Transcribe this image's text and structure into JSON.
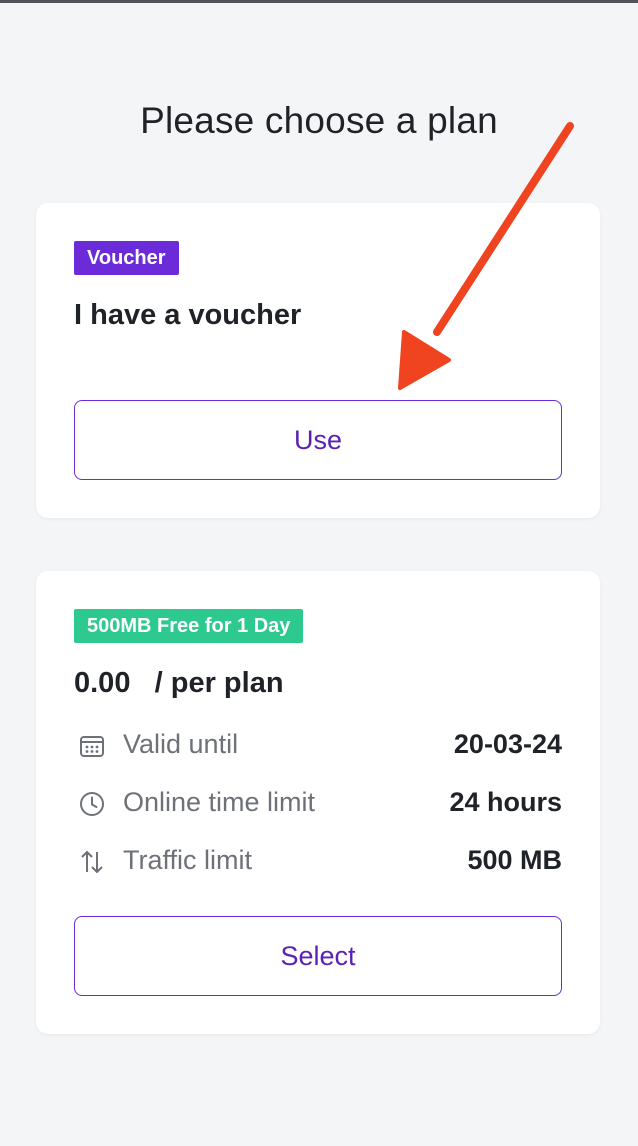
{
  "page": {
    "title": "Please choose a plan"
  },
  "voucher_card": {
    "badge": "Voucher",
    "heading": "I have a voucher",
    "button_label": "Use"
  },
  "plan_card": {
    "badge": "500MB Free for 1 Day",
    "price": "0.00",
    "price_suffix": "/ per plan",
    "rows": [
      {
        "icon": "calendar-icon",
        "label": "Valid until",
        "value": "20-03-24"
      },
      {
        "icon": "clock-icon",
        "label": "Online time limit",
        "value": "24 hours"
      },
      {
        "icon": "up-down-arrows-icon",
        "label": "Traffic limit",
        "value": "500 MB"
      }
    ],
    "button_label": "Select"
  },
  "colors": {
    "accent": "#6c2bd9",
    "voucher_badge": "#6c2bd9",
    "plan_badge": "#2ec98f",
    "annotation_arrow": "#f0431f",
    "background": "#f4f5f7"
  }
}
